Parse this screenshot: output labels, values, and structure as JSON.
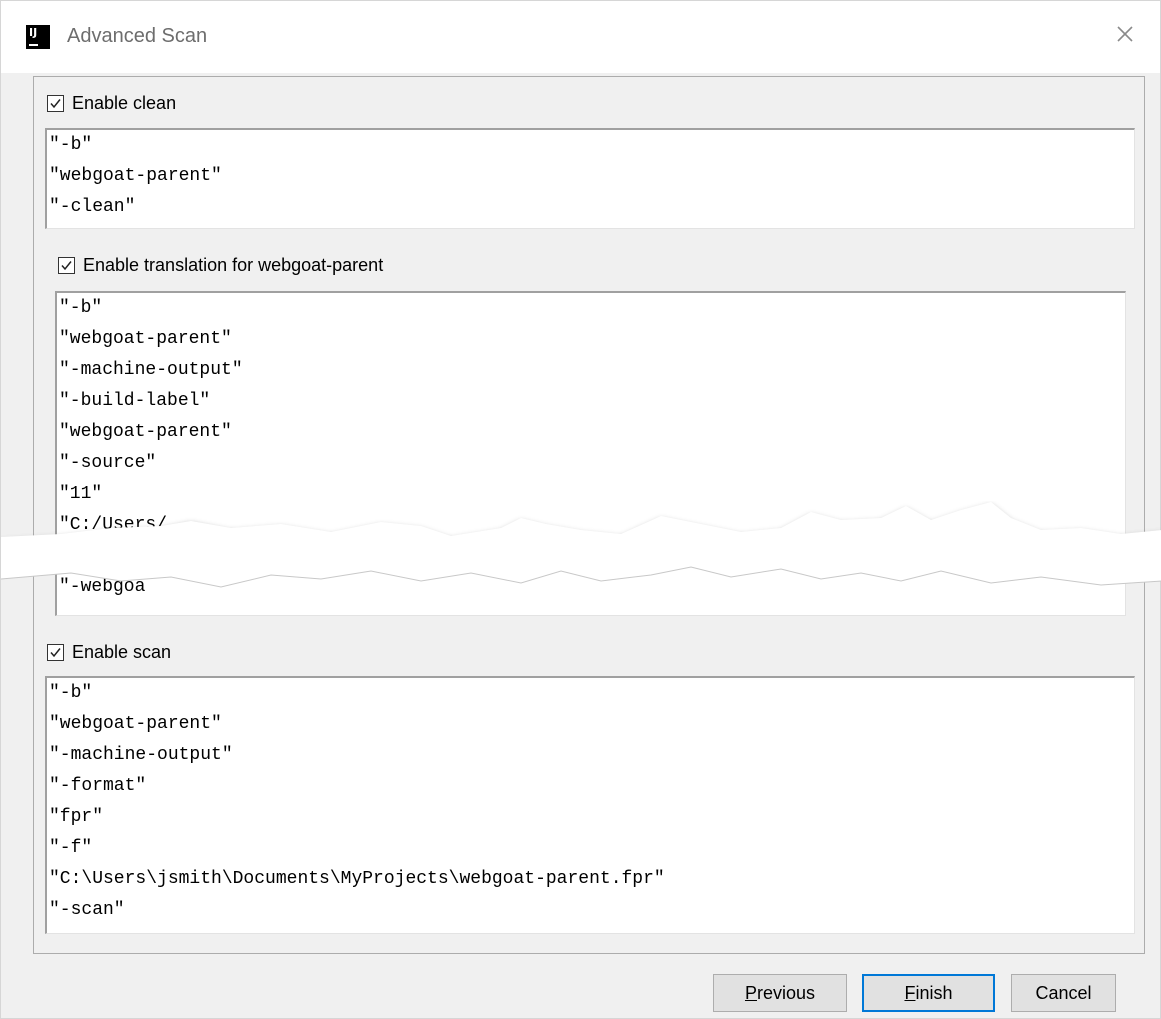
{
  "window": {
    "title": "Advanced Scan",
    "logo_text": "IJ"
  },
  "clean": {
    "label": "Enable clean",
    "checked": true,
    "lines": [
      "\"-b\"",
      "\"webgoat-parent\"",
      "\"-clean\""
    ]
  },
  "translation": {
    "label": "Enable translation for webgoat-parent",
    "checked": true,
    "lines": [
      "\"-b\"",
      "\"webgoat-parent\"",
      "\"-machine-output\"",
      "\"-build-label\"",
      "\"webgoat-parent\"",
      "\"-source\"",
      "\"11\"",
      "\"C:/Users/",
      "",
      "\"-webgoa"
    ]
  },
  "scan": {
    "label": "Enable scan",
    "checked": true,
    "lines": [
      "\"-b\"",
      "\"webgoat-parent\"",
      "\"-machine-output\"",
      "\"-format\"",
      "\"fpr\"",
      "\"-f\"",
      "\"C:\\Users\\jsmith\\Documents\\MyProjects\\webgoat-parent.fpr\"",
      "\"-scan\""
    ]
  },
  "buttons": {
    "previous": {
      "mnemonic": "P",
      "rest": "revious"
    },
    "finish": {
      "mnemonic": "F",
      "rest": "inish"
    },
    "cancel": {
      "label": "Cancel"
    }
  },
  "colors": {
    "focus_border": "#0078d7",
    "dialog_bg": "#f0f0f0"
  }
}
